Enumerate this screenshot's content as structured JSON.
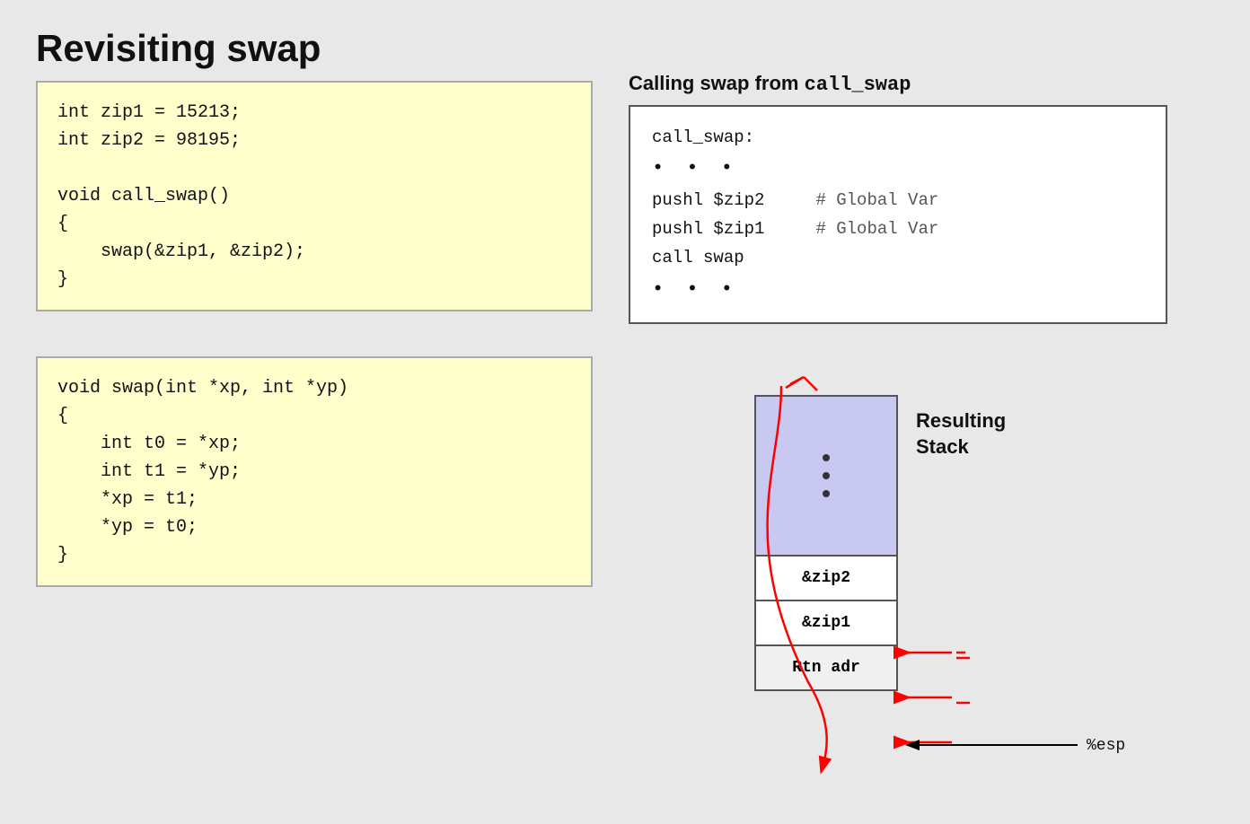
{
  "page": {
    "title": "Revisiting swap",
    "background": "#e8e8e8"
  },
  "top_code": {
    "lines": [
      "int zip1 = 15213;",
      "int zip2 = 98195;",
      "",
      "void call_swap()",
      "{",
      "    swap(&zip1, &zip2);",
      "}"
    ]
  },
  "bottom_code": {
    "lines": [
      "void swap(int *xp, int *yp)",
      "{",
      "    int t0 = *xp;",
      "    int t1 = *yp;",
      "    *xp = t1;",
      "    *yp = t0;",
      "}"
    ]
  },
  "asm_title": "Calling swap from call_swap",
  "asm_box": {
    "label": "call_swap:",
    "dots1": "• • •",
    "line1": "pushl $zip2",
    "comment1": "# Global Var",
    "line2": "pushl $zip1",
    "comment2": "# Global Var",
    "line3": "call swap",
    "dots2": "• • •"
  },
  "stack": {
    "label": "Resulting\nStack",
    "cells": [
      {
        "text": "&zip2"
      },
      {
        "text": "&zip1"
      },
      {
        "text": "Rtn adr"
      }
    ],
    "esp_label": "%esp"
  }
}
